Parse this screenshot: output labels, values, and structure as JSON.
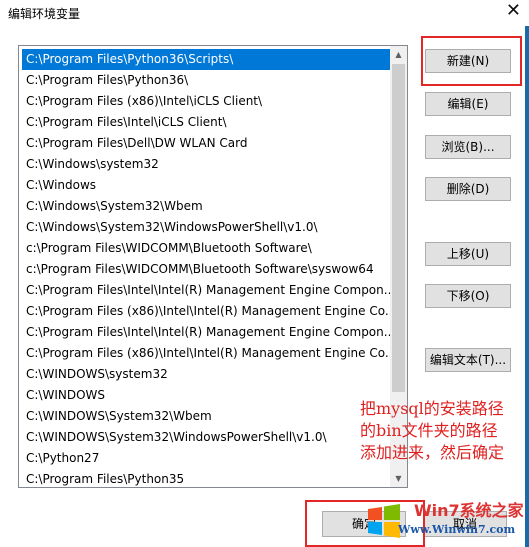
{
  "window": {
    "title": "编辑环境变量",
    "close": "✕"
  },
  "paths": [
    "C:\\Program Files\\Python36\\Scripts\\",
    "C:\\Program Files\\Python36\\",
    "C:\\Program Files (x86)\\Intel\\iCLS Client\\",
    "C:\\Program Files\\Intel\\iCLS Client\\",
    "C:\\Program Files\\Dell\\DW WLAN Card",
    "C:\\Windows\\system32",
    "C:\\Windows",
    "C:\\Windows\\System32\\Wbem",
    "C:\\Windows\\System32\\WindowsPowerShell\\v1.0\\",
    "c:\\Program Files\\WIDCOMM\\Bluetooth Software\\",
    "c:\\Program Files\\WIDCOMM\\Bluetooth Software\\syswow64",
    "C:\\Program Files\\Intel\\Intel(R) Management Engine Compon...",
    "C:\\Program Files (x86)\\Intel\\Intel(R) Management Engine Co...",
    "C:\\Program Files\\Intel\\Intel(R) Management Engine Compon...",
    "C:\\Program Files (x86)\\Intel\\Intel(R) Management Engine Co...",
    "C:\\WINDOWS\\system32",
    "C:\\WINDOWS",
    "C:\\WINDOWS\\System32\\Wbem",
    "C:\\WINDOWS\\System32\\WindowsPowerShell\\v1.0\\",
    "C:\\Python27",
    "C:\\Program Files\\Python35"
  ],
  "buttons": {
    "new": "新建(N)",
    "edit": "编辑(E)",
    "browse": "浏览(B)...",
    "delete": "删除(D)",
    "move_up": "上移(U)",
    "move_down": "下移(O)",
    "edit_text": "编辑文本(T)...",
    "ok": "确定",
    "cancel": "取消"
  },
  "annotation": {
    "line1": "把mysql的安装路径",
    "line2": "的bin文件夹的路径",
    "line3": "添加进来，然后确定"
  },
  "watermark": {
    "line1": "Win7系统之家",
    "line2": "Www.Winwin7.com"
  },
  "colors": {
    "selection": "#0078d7",
    "annotation": "#e02020",
    "highlight_box": "#e32626"
  }
}
